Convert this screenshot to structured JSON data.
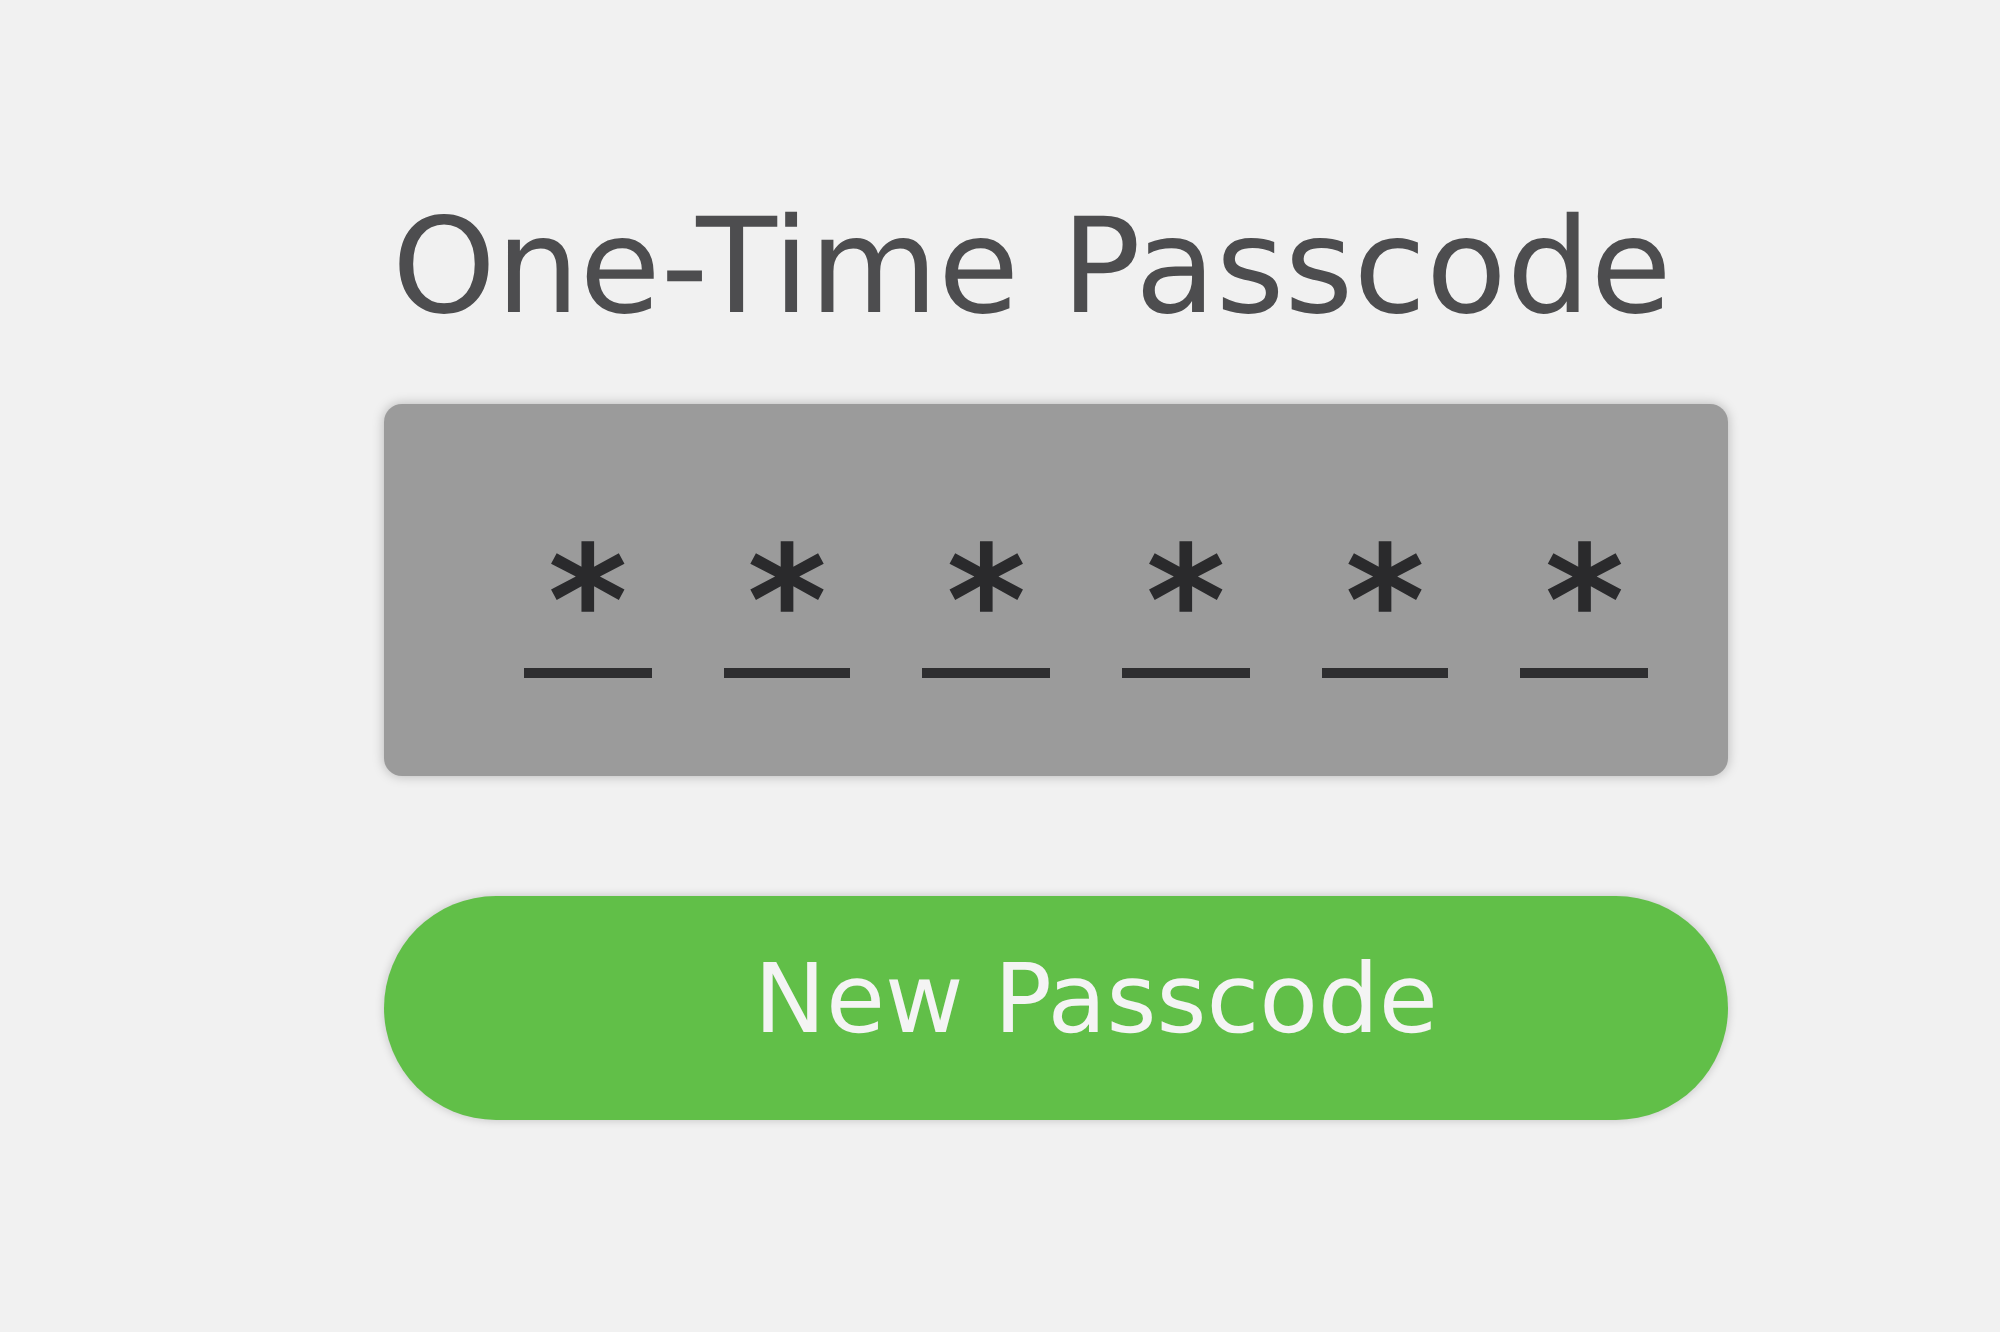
{
  "title": "One-Time Passcode",
  "passcode": {
    "digits": [
      "*",
      "*",
      "*",
      "*",
      "*",
      "*"
    ]
  },
  "button": {
    "label": "New Passcode"
  }
}
